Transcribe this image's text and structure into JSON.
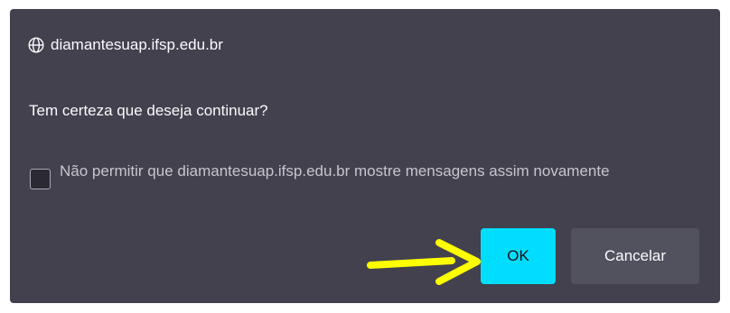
{
  "dialog": {
    "origin": "diamantesuap.ifsp.edu.br",
    "origin_icon": "globe-icon",
    "message": "Tem certeza que deseja continuar?",
    "checkbox_label": "Não permitir que diamantesuap.ifsp.edu.br mostre mensagens assim novamente",
    "checkbox_checked": false,
    "ok_label": "OK",
    "cancel_label": "Cancelar"
  },
  "annotation": {
    "icon": "arrow-right-icon",
    "color": "#ffff00"
  },
  "colors": {
    "dialog_background": "#42414d",
    "ok_button": "#00ddff",
    "cancel_button": "#52525e"
  }
}
